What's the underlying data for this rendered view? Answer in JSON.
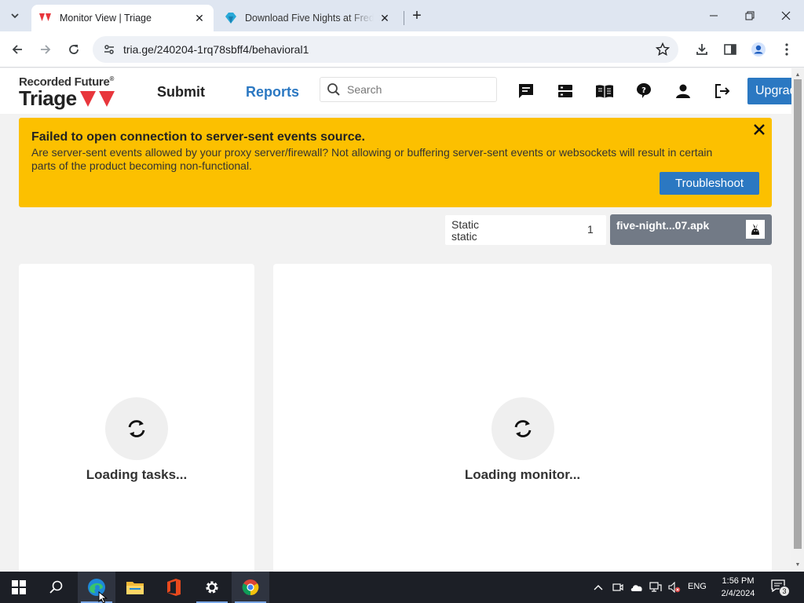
{
  "browser": {
    "tabs": [
      {
        "title": "Monitor View | Triage",
        "active": true
      },
      {
        "title": "Download Five Nights at Freddy's",
        "active": false
      }
    ],
    "url": "tria.ge/240204-1rq78sbff4/behavioral1"
  },
  "header": {
    "logo_top": "Recorded Future",
    "logo_registered": "®",
    "logo_bottom": "Triage",
    "nav": {
      "submit": "Submit",
      "reports": "Reports"
    },
    "search_placeholder": "Search",
    "upgrade_label": "Upgrade",
    "icons": [
      "chat-icon",
      "server-icon",
      "book-icon",
      "help-icon",
      "user-icon",
      "logout-icon"
    ]
  },
  "alert": {
    "heading": "Failed to open connection to server-sent events source.",
    "message": "Are server-sent events allowed by your proxy server/firewall? Not allowing or buffering server-sent events or websockets will result in certain parts of the product becoming non-functional.",
    "button": "Troubleshoot"
  },
  "static_box": {
    "line1": "Static",
    "line2": "static",
    "count": "1"
  },
  "file_box": {
    "name": "five-night...07.apk",
    "icon": "android-icon"
  },
  "panels": {
    "tasks": {
      "loading": "Loading tasks..."
    },
    "monitor": {
      "loading": "Loading monitor..."
    }
  },
  "taskbar": {
    "apps": [
      "start-icon",
      "search-icon",
      "edge-icon",
      "file-explorer-icon",
      "office-icon",
      "settings-icon",
      "chrome-icon"
    ],
    "language": "ENG",
    "time": "1:56 PM",
    "date": "2/4/2024",
    "notifications": "3"
  },
  "colors": {
    "alert": "#fcc000",
    "brand_blue": "#2b78c2",
    "logo_red": "#e8363c",
    "file_box": "#727a86"
  }
}
